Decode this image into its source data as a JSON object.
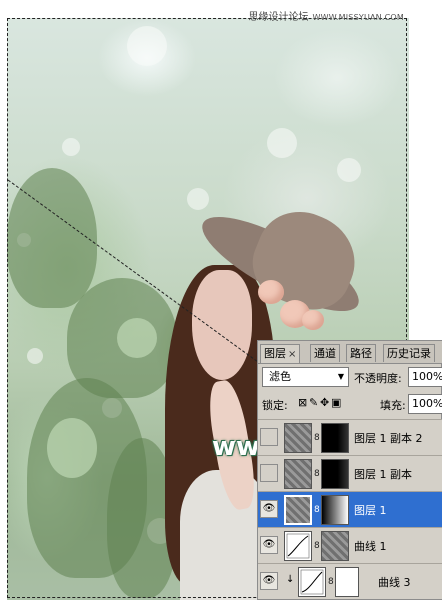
{
  "watermark_top": {
    "cn": "思缘设计论坛",
    "en": "WWW.MISSYUAN.COM"
  },
  "watermark_mid": "www.68ps.com",
  "panel": {
    "tabs": [
      {
        "label": "图层",
        "close": "×",
        "active": true
      },
      {
        "label": "通道",
        "active": false
      },
      {
        "label": "路径",
        "active": false
      },
      {
        "label": "历史记录",
        "active": false
      }
    ],
    "blend_mode": "滤色",
    "opacity_label": "不透明度:",
    "opacity_value": "100%",
    "lock_label": "锁定:",
    "lock_icons": [
      "transparency-lock-icon",
      "brush-lock-icon",
      "move-lock-icon",
      "padlock-icon"
    ],
    "fill_label": "填充:",
    "fill_value": "100%",
    "layers": [
      {
        "name": "图层 1 副本 2",
        "visible": false,
        "selected": false
      },
      {
        "name": "图层 1 副本",
        "visible": false,
        "selected": false
      },
      {
        "name": "图层 1",
        "visible": true,
        "selected": true
      },
      {
        "name": "曲线 1",
        "visible": true,
        "selected": false
      },
      {
        "name": "曲线 3",
        "visible": true,
        "selected": false,
        "clipped": true
      }
    ],
    "selection_color": "#2f6fd0"
  }
}
